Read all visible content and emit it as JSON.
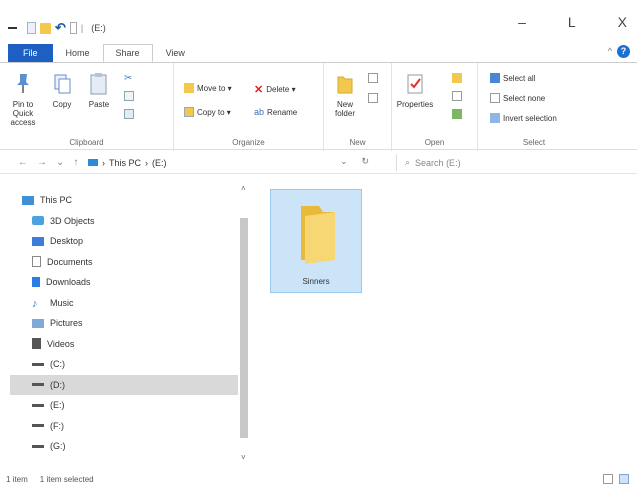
{
  "titlebar": {
    "title": "(E:)",
    "separator": "|",
    "minimize": "–",
    "maximize": "L",
    "close": "X"
  },
  "tabs": {
    "file": "File",
    "home": "Home",
    "share": "Share",
    "view": "View",
    "minimize_ribbon": "^"
  },
  "ribbon": {
    "clipboard": {
      "label": "Clipboard",
      "pin": "Pin to Quick access",
      "copy": "Copy",
      "paste": "Paste"
    },
    "organize": {
      "label": "Organize",
      "move_to": "Move to ▾",
      "delete": "Delete ▾",
      "copy_to": "Copy to ▾",
      "rename": "Rename"
    },
    "new": {
      "label": "New",
      "new_folder": "New folder"
    },
    "open": {
      "label": "Open",
      "properties": "Properties"
    },
    "select": {
      "label": "Select",
      "select_all": "Select all",
      "select_none": "Select none",
      "invert": "Invert selection"
    }
  },
  "address": {
    "back": "←",
    "forward": "→",
    "recent": "⌄",
    "up": "↑",
    "path": [
      "This PC",
      "(E:)"
    ],
    "dropdown": "⌄",
    "refresh": "↻",
    "search_placeholder": "Search (E:)"
  },
  "navpane": {
    "items": [
      {
        "label": "This PC",
        "icon": "computer-icon"
      },
      {
        "label": "3D Objects",
        "icon": "cube-icon"
      },
      {
        "label": "Desktop",
        "icon": "desktop-icon"
      },
      {
        "label": "Documents",
        "icon": "documents-icon"
      },
      {
        "label": "Downloads",
        "icon": "download-icon"
      },
      {
        "label": "Music",
        "icon": "music-icon"
      },
      {
        "label": "Pictures",
        "icon": "pictures-icon"
      },
      {
        "label": "Videos",
        "icon": "videos-icon"
      },
      {
        "label": "(C:)",
        "icon": "drive-icon"
      },
      {
        "label": "(D:)",
        "icon": "drive-icon"
      },
      {
        "label": "(E:)",
        "icon": "drive-icon"
      },
      {
        "label": "(F:)",
        "icon": "drive-icon"
      },
      {
        "label": "(G:)",
        "icon": "drive-icon"
      }
    ],
    "selected_index": 9,
    "scroll_up": "˄",
    "scroll_down": "˅"
  },
  "content": {
    "folder_name": "Sinners"
  },
  "status": {
    "item_count": "1 item",
    "selected": "1 item selected"
  },
  "colors": {
    "accent": "#1d5fc2",
    "selection": "#cce4f7",
    "folder": "#f2c94c"
  }
}
